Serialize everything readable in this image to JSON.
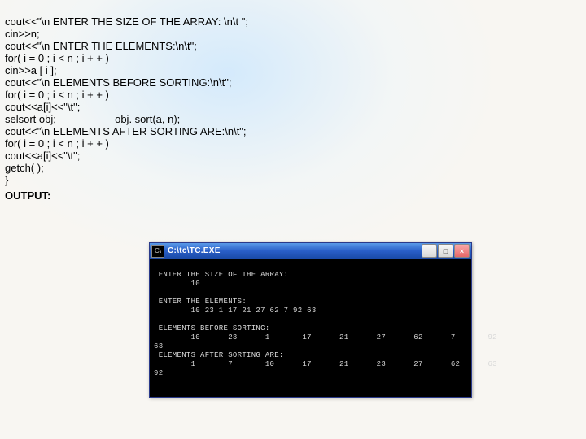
{
  "code": {
    "lines": [
      "cout<<\"\\n ENTER THE SIZE OF THE ARRAY: \\n\\t \";",
      "cin>>n;",
      "cout<<\"\\n ENTER THE ELEMENTS:\\n\\t\";",
      "for( i = 0 ; i < n ; i + + )",
      "cin>>a [ i ];",
      "cout<<\"\\n ELEMENTS BEFORE SORTING:\\n\\t\";",
      "for( i = 0 ; i < n ; i + + )",
      "cout<<a[i]<<\"\\t\";",
      "selsort obj;                    obj. sort(a, n);",
      "cout<<\"\\n ELEMENTS AFTER SORTING ARE:\\n\\t\";",
      "for( i = 0 ; i < n ; i + + )",
      "cout<<a[i]<<\"\\t\";",
      "getch( );",
      "}"
    ]
  },
  "output_label": "OUTPUT:",
  "console": {
    "title": "C:\\tc\\TC.EXE",
    "btn_min": "_",
    "btn_max": "□",
    "btn_close": "×",
    "body_lines": [
      "",
      " ENTER THE SIZE OF THE ARRAY:",
      "        10",
      "",
      " ENTER THE ELEMENTS:",
      "        10 23 1 17 21 27 62 7 92 63",
      "",
      " ELEMENTS BEFORE SORTING:",
      "        10      23      1       17      21      27      62      7       92",
      "63",
      " ELEMENTS AFTER SORTING ARE:",
      "        1       7       10      17      21      23      27      62      63",
      "92"
    ]
  }
}
